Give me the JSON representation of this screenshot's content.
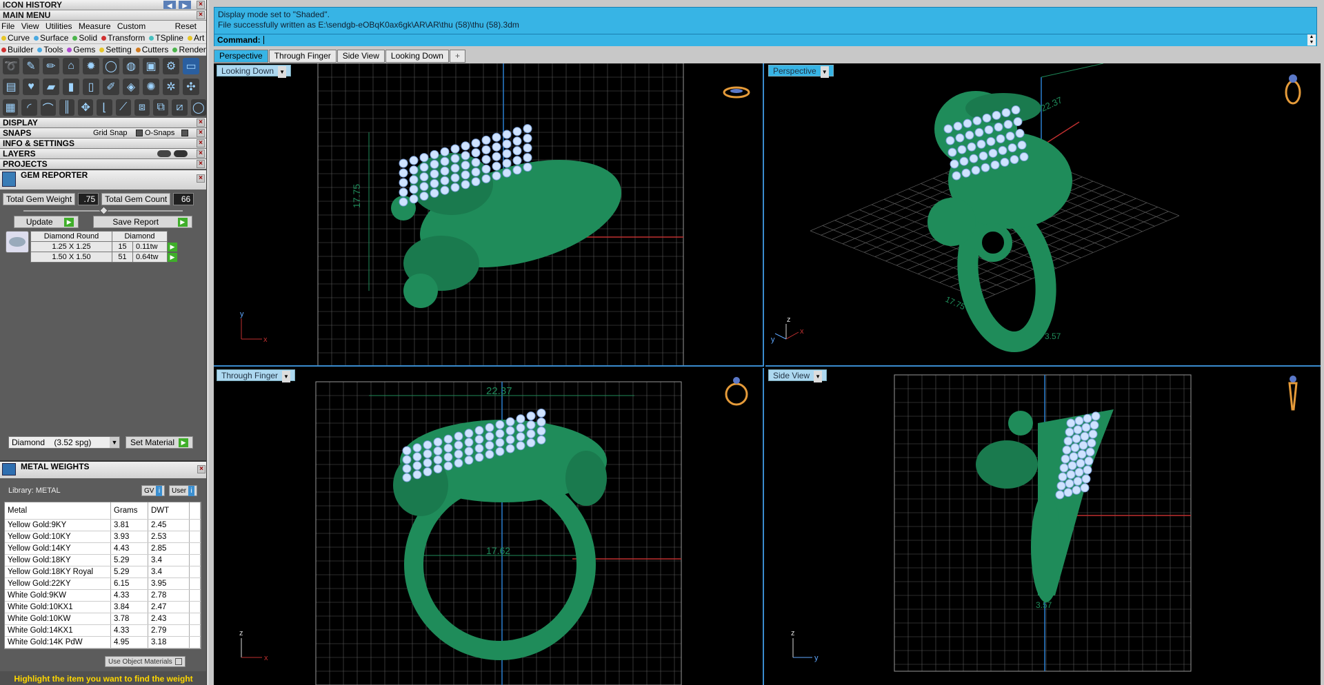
{
  "left": {
    "icon_history": "ICON HISTORY",
    "main_menu": "MAIN MENU",
    "menu": [
      "File",
      "View",
      "Utilities",
      "Measure",
      "Custom"
    ],
    "reset": "Reset",
    "row2": [
      {
        "label": "Curve",
        "color": "#e6c629"
      },
      {
        "label": "Surface",
        "color": "#4aa9e0"
      },
      {
        "label": "Solid",
        "color": "#4bb44b"
      },
      {
        "label": "Transform",
        "color": "#d03030"
      },
      {
        "label": "TSpline",
        "color": "#48c0c0"
      },
      {
        "label": "Art",
        "color": "#e6c629"
      }
    ],
    "row3": [
      {
        "label": "Builder",
        "color": "#d03030"
      },
      {
        "label": "Tools",
        "color": "#4aa9e0"
      },
      {
        "label": "Gems",
        "color": "#b04bd0"
      },
      {
        "label": "Setting",
        "color": "#e6c629"
      },
      {
        "label": "Cutters",
        "color": "#d07a20"
      },
      {
        "label": "Render",
        "color": "#4bb44b"
      }
    ],
    "display": "DISPLAY",
    "snaps": "SNAPS",
    "grid_snap": "Grid Snap",
    "o_snaps": "O-Snaps",
    "info_settings": "INFO & SETTINGS",
    "layers": "LAYERS",
    "projects": "PROJECTS",
    "gem_reporter": "GEM REPORTER",
    "total_gem_weight_label": "Total Gem Weight",
    "total_gem_weight": ".75",
    "total_gem_count_label": "Total Gem Count",
    "total_gem_count": "66",
    "update": "Update",
    "save_report": "Save Report",
    "gem_header": [
      "Diamond Round",
      "Diamond"
    ],
    "gem_rows": [
      {
        "size": "1.25 X 1.25",
        "count": "15",
        "tw": "0.11tw"
      },
      {
        "size": "1.50 X 1.50",
        "count": "51",
        "tw": "0.64tw"
      }
    ],
    "material_select": "Diamond    (3.52 spg)",
    "set_material": "Set Material",
    "metal_weights": "METAL WEIGHTS",
    "library": "Library: METAL",
    "gv": "GV",
    "user": "User",
    "metal_cols": [
      "Metal",
      "Grams",
      "DWT"
    ],
    "metals": [
      [
        "Yellow Gold:9KY",
        "3.81",
        "2.45"
      ],
      [
        "Yellow Gold:10KY",
        "3.93",
        "2.53"
      ],
      [
        "Yellow Gold:14KY",
        "4.43",
        "2.85"
      ],
      [
        "Yellow Gold:18KY",
        "5.29",
        "3.4"
      ],
      [
        "Yellow Gold:18KY Royal",
        "5.29",
        "3.4"
      ],
      [
        "Yellow Gold:22KY",
        "6.15",
        "3.95"
      ],
      [
        "White Gold:9KW",
        "4.33",
        "2.78"
      ],
      [
        "White Gold:10KX1",
        "3.84",
        "2.47"
      ],
      [
        "White Gold:10KW",
        "3.78",
        "2.43"
      ],
      [
        "White Gold:14KX1",
        "4.33",
        "2.79"
      ],
      [
        "White Gold:14K PdW",
        "4.95",
        "3.18"
      ]
    ],
    "use_object_materials": "Use Object Materials",
    "highlight": "Highlight the item you want to find the weight"
  },
  "cmd": {
    "line1": "Display mode set to \"Shaded\".",
    "line2": "File successfully written as E:\\sendgb-eOBqK0ax6gk\\AR\\AR\\thu (58)\\thu  (58).3dm",
    "command_label": "Command:"
  },
  "tabs": [
    "Perspective",
    "Through Finger",
    "Side View",
    "Looking Down",
    "+"
  ],
  "viewports": {
    "tl": {
      "label": "Looking Down",
      "dim": "17.75",
      "axis1": "y",
      "axis2": "x"
    },
    "tr": {
      "label": "Perspective",
      "dim1": "22.37",
      "dim2": "17.75",
      "dim3": "3.57",
      "axis1": "z",
      "axis2": "x",
      "axis3": "y"
    },
    "bl": {
      "label": "Through Finger",
      "dim1": "22.37",
      "dim2": "17.62",
      "axis1": "z",
      "axis2": "x"
    },
    "br": {
      "label": "Side View",
      "dim": "3.57",
      "axis1": "z",
      "axis2": "y"
    }
  },
  "colors": {
    "ring": "#1f8c5a",
    "gem": "#cfe3ff",
    "grid": "#5a5a5a",
    "accent": "#37b4e5"
  }
}
